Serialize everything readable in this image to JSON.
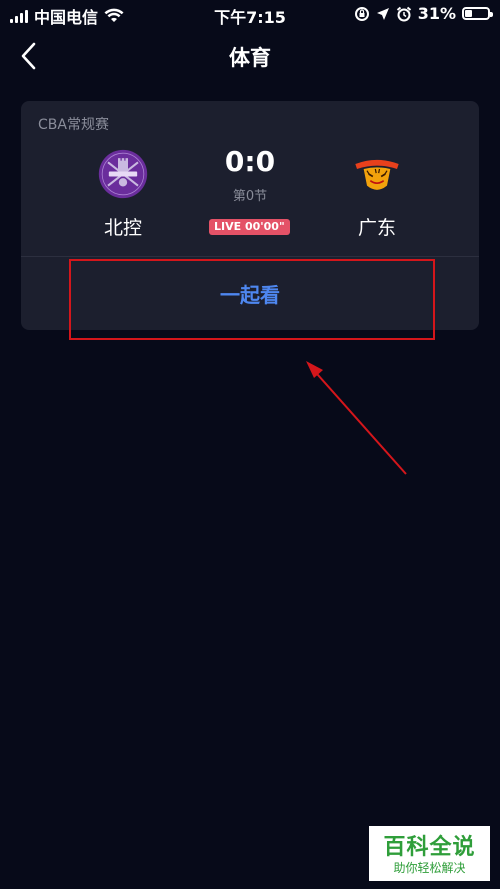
{
  "status_bar": {
    "carrier": "中国电信",
    "time": "下午7:15",
    "battery_percent": "31%",
    "battery_level": 0.31,
    "icons": [
      "signal-icon",
      "wifi-icon",
      "screen-lock-icon",
      "location-icon",
      "alarm-icon",
      "battery-icon"
    ]
  },
  "nav": {
    "title": "体育",
    "back_icon": "chevron-left-icon"
  },
  "card": {
    "league": "CBA常规赛",
    "home_team": {
      "name": "北控",
      "logo": "team-logo-royal-fighters"
    },
    "away_team": {
      "name": "广东",
      "logo": "team-logo-southern-tigers"
    },
    "score": "0:0",
    "period": "第0节",
    "live_badge": "LIVE 00'00\"",
    "watch_button": "一起看"
  },
  "annotation": {
    "highlight_color": "#d4161b",
    "arrow_color": "#d4161b"
  },
  "watermark": {
    "title": "百科全说",
    "subtitle": "助你轻松解决"
  }
}
